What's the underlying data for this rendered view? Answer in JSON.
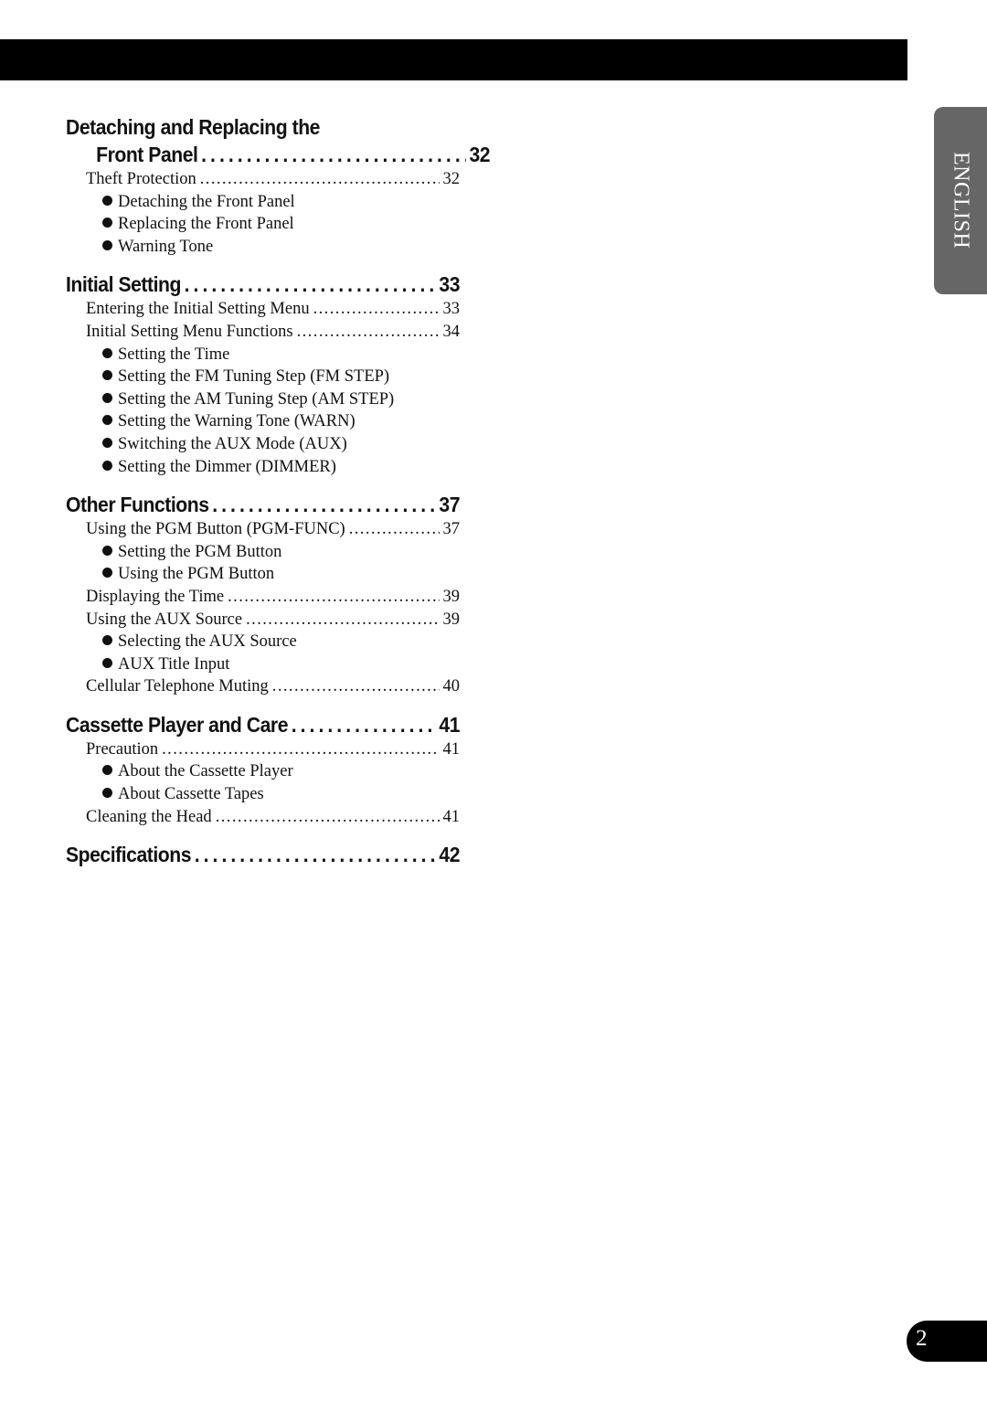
{
  "language_tab": "ENGLISH",
  "page_number": "2",
  "sections": [
    {
      "title_line1": "Detaching and Replacing the",
      "title_line2": "Front Panel",
      "page": "32",
      "items": [
        {
          "type": "entry",
          "label": "Theft Protection",
          "page": "32"
        },
        {
          "type": "bullet",
          "label": "Detaching the Front Panel"
        },
        {
          "type": "bullet",
          "label": "Replacing the Front Panel"
        },
        {
          "type": "bullet",
          "label": "Warning Tone"
        }
      ]
    },
    {
      "title": "Initial Setting",
      "page": "33",
      "items": [
        {
          "type": "entry",
          "label": "Entering the Initial Setting Menu",
          "page": "33"
        },
        {
          "type": "entry",
          "label": "Initial Setting Menu Functions",
          "page": "34"
        },
        {
          "type": "bullet",
          "label": "Setting the Time"
        },
        {
          "type": "bullet",
          "label": "Setting the FM Tuning Step (FM STEP)"
        },
        {
          "type": "bullet",
          "label": "Setting the AM Tuning Step (AM STEP)"
        },
        {
          "type": "bullet",
          "label": "Setting the Warning Tone (WARN)"
        },
        {
          "type": "bullet",
          "label": "Switching the AUX Mode (AUX)"
        },
        {
          "type": "bullet",
          "label": "Setting the Dimmer (DIMMER)"
        }
      ]
    },
    {
      "title": "Other Functions",
      "page": "37",
      "items": [
        {
          "type": "entry",
          "label": "Using the PGM Button (PGM-FUNC)",
          "page": "37"
        },
        {
          "type": "bullet",
          "label": "Setting the PGM Button"
        },
        {
          "type": "bullet",
          "label": "Using the PGM Button"
        },
        {
          "type": "entry",
          "label": "Displaying the Time",
          "page": "39"
        },
        {
          "type": "entry",
          "label": "Using the AUX Source",
          "page": "39"
        },
        {
          "type": "bullet",
          "label": "Selecting the AUX Source"
        },
        {
          "type": "bullet",
          "label": "AUX Title Input"
        },
        {
          "type": "entry",
          "label": "Cellular Telephone Muting",
          "page": "40"
        }
      ]
    },
    {
      "title": "Cassette Player and Care",
      "page": "41",
      "items": [
        {
          "type": "entry",
          "label": "Precaution",
          "page": "41"
        },
        {
          "type": "bullet",
          "label": "About the Cassette Player"
        },
        {
          "type": "bullet",
          "label": "About Cassette Tapes"
        },
        {
          "type": "entry",
          "label": "Cleaning the Head",
          "page": "41"
        }
      ]
    },
    {
      "title": "Specifications",
      "page": "42",
      "items": []
    }
  ]
}
